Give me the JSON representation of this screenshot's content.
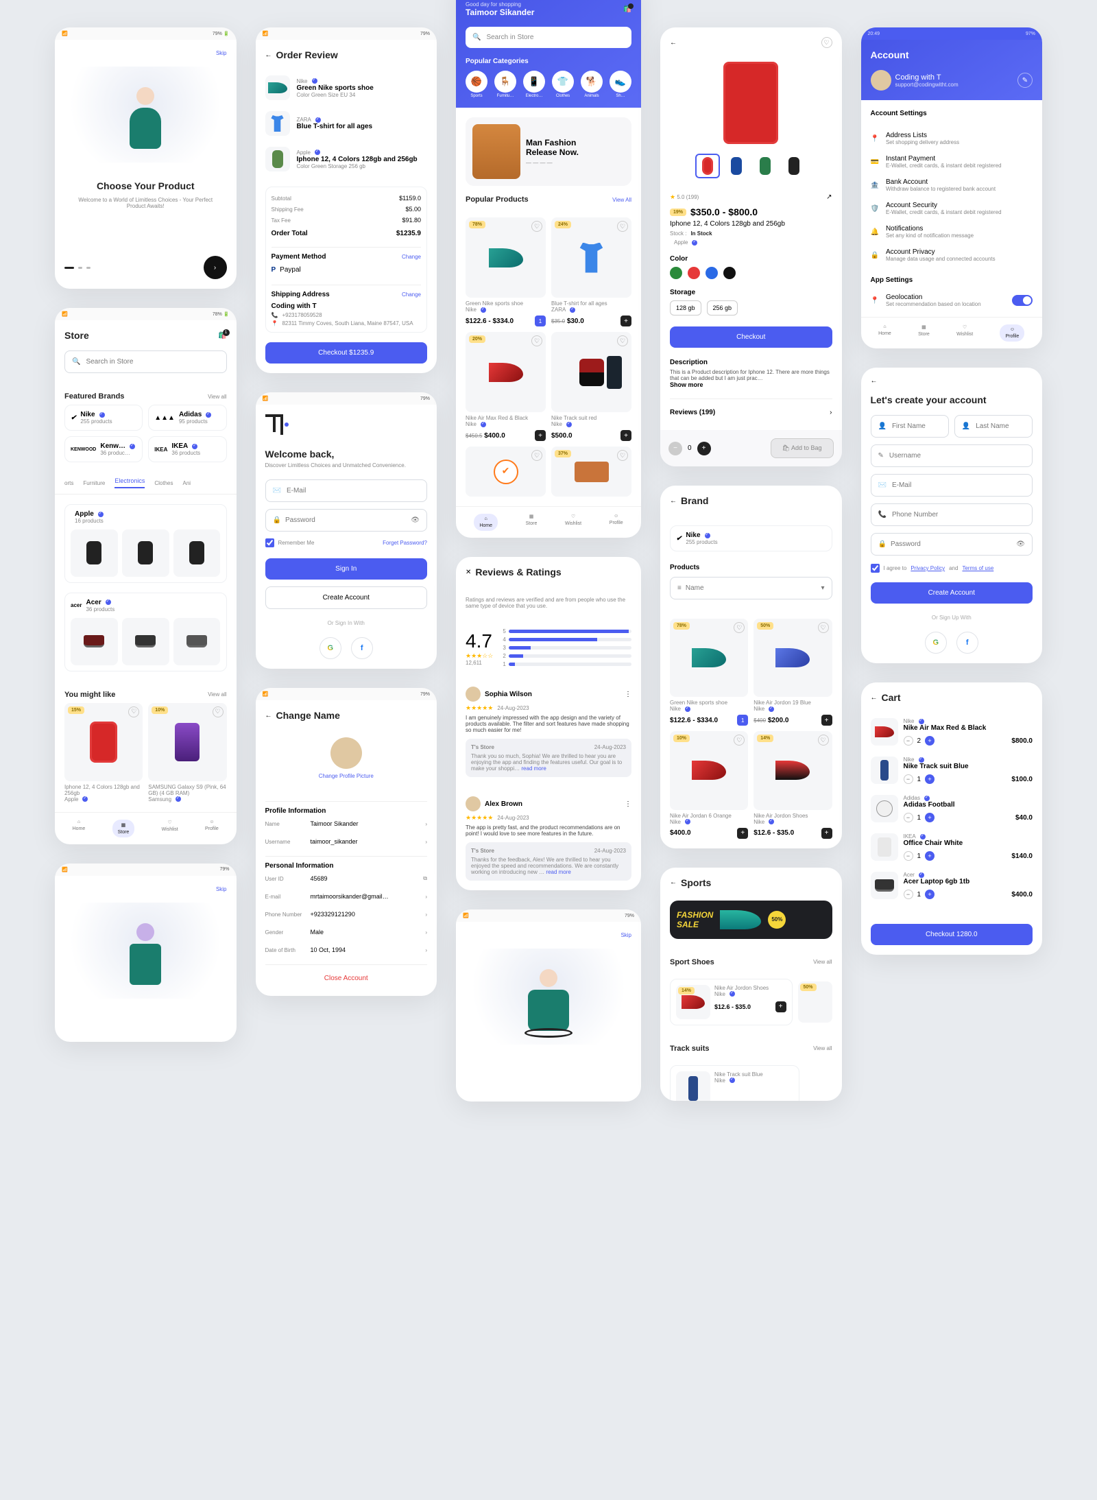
{
  "onboard1": {
    "skip": "Skip",
    "title": "Choose Your Product",
    "desc": "Welcome to a World of Limitless Choices - Your Perfect Product Awaits!"
  },
  "order": {
    "title": "Order Review",
    "items": [
      {
        "brand": "Nike",
        "name": "Green Nike sports shoe",
        "attrs": "Color Green  Size EU 34"
      },
      {
        "brand": "ZARA",
        "name": "Blue T-shirt for all ages"
      },
      {
        "brand": "Apple",
        "name": "Iphone 12, 4 Colors 128gb and 256gb",
        "attrs": "Color Green  Storage 256 gb"
      }
    ],
    "summary": {
      "subtotal_l": "Subtotal",
      "subtotal_v": "$1159.0",
      "ship_l": "Shipping Fee",
      "ship_v": "$5.00",
      "tax_l": "Tax Fee",
      "tax_v": "$91.80",
      "total_l": "Order Total",
      "total_v": "$1235.9"
    },
    "payment_title": "Payment Method",
    "change": "Change",
    "paypal": "Paypal",
    "ship_title": "Shipping Address",
    "ship_name": "Coding with T",
    "ship_phone": "+923178059528",
    "ship_addr": "82311 Timmy Coves, South Liana, Maine 87547, USA",
    "checkout": "Checkout $1235.9"
  },
  "home": {
    "greet1": "Good day for shopping",
    "greet2": "Taimoor Sikander",
    "search": "Search in Store",
    "cat_title": "Popular Categories",
    "cats": [
      "Sports",
      "Furnitu…",
      "Electro…",
      "Clothes",
      "Animals",
      "Sh…"
    ],
    "banner_title": "Man Fashion\nRelease Now.",
    "pp_title": "Popular Products",
    "view_all": "View All",
    "p": [
      {
        "disc": "78%",
        "name": "Green Nike sports shoe",
        "brand": "Nike",
        "price": "$122.6 - $334.0"
      },
      {
        "disc": "24%",
        "name": "Blue T-shirt for all ages",
        "brand": "ZARA",
        "p_old": "$35.0",
        "price": "$30.0"
      },
      {
        "disc": "20%",
        "name": "Nike Air Max Red & Black",
        "brand": "Nike",
        "p_old": "$450.5",
        "price": "$400.0"
      },
      {
        "name": "Nike Track suit red",
        "brand": "Nike",
        "price": "$500.0"
      },
      {
        "disc": "37%"
      }
    ],
    "nav": [
      "Home",
      "Store",
      "Wishlist",
      "Profile"
    ]
  },
  "pdp": {
    "rating": "5.0 (199)",
    "disc": "19%",
    "price": "$350.0 - $800.0",
    "title": "Iphone 12, 4 Colors 128gb and 256gb",
    "stock_l": "Stock :",
    "stock": "In Stock",
    "brand": "Apple",
    "color_l": "Color",
    "storage_l": "Storage",
    "storages": [
      "128 gb",
      "256 gb"
    ],
    "checkout": "Checkout",
    "desc_l": "Description",
    "desc": "This is a Product description for Iphone 12. There are more things that can be added but I am just prac…",
    "showmore": "Show more",
    "reviews": "Reviews (199)",
    "bag": "Add to Bag",
    "qty": "0"
  },
  "account": {
    "time": "20:49",
    "title": "Account",
    "name": "Coding with T",
    "email": "support@codingwitht.com",
    "sect1": "Account Settings",
    "items": [
      {
        "t": "Address Lists",
        "s": "Set shopping delivery address",
        "icon": "📍"
      },
      {
        "t": "Instant Payment",
        "s": "E-Wallet, credit cards, & instant debit registered",
        "icon": "💳"
      },
      {
        "t": "Bank Account",
        "s": "Withdraw balance to registered bank account",
        "icon": "🏦"
      },
      {
        "t": "Account Security",
        "s": "E-Wallet, credit cards, & instant debit registered",
        "icon": "🛡️"
      },
      {
        "t": "Notifications",
        "s": "Set any kind of notification message",
        "icon": "🔔"
      },
      {
        "t": "Account Privacy",
        "s": "Manage data usage and connected accounts",
        "icon": "🔒"
      }
    ],
    "sect2": "App Settings",
    "geo_t": "Geolocation",
    "geo_s": "Set recommendation based on location",
    "nav": [
      "Home",
      "Store",
      "Wishlist",
      "Profile"
    ]
  },
  "store": {
    "title": "Store",
    "search": "Search in Store",
    "fb": "Featured Brands",
    "view": "View all",
    "brands": [
      {
        "n": "Nike",
        "s": "255 products"
      },
      {
        "n": "Adidas",
        "s": "95 products"
      },
      {
        "n": "Kenw…",
        "s": "36 produc…"
      },
      {
        "n": "IKEA",
        "s": "36 products"
      }
    ],
    "tabs": [
      "orts",
      "Furniture",
      "Electronics",
      "Clothes",
      "Ani"
    ],
    "apple_n": "Apple",
    "apple_s": "16 products",
    "acer_n": "Acer",
    "acer_s": "36 products",
    "like": "You might like",
    "rec1_disc": "15%",
    "rec1_n": "Iphone 12, 4 Colors 128gb and 256gb",
    "rec1_b": "Apple",
    "rec2_disc": "10%",
    "rec2_n": "SAMSUNG Galaxy S9 (Pink, 64 GB) (4 GB RAM)",
    "rec2_b": "Samsung",
    "nav": [
      "Home",
      "Store",
      "Wishlist",
      "Profile"
    ]
  },
  "login": {
    "welcome": "Welcome back,",
    "sub": "Discover Limitless Choices and Unmatched Convenience.",
    "email": "E-Mail",
    "password": "Password",
    "remember": "Remember Me",
    "forgot": "Forget Password?",
    "signin": "Sign In",
    "create": "Create Account",
    "orsign": "Or Sign In With"
  },
  "profile": {
    "title": "Change Name",
    "pic": "Change Profile Picture",
    "sect1": "Profile Information",
    "name_l": "Name",
    "name_v": "Taimoor Sikander",
    "user_l": "Username",
    "user_v": "taimoor_sikander",
    "sect2": "Personal Information",
    "uid_l": "User ID",
    "uid_v": "45689",
    "email_l": "E-mail",
    "email_v": "mrtaimoorsikander@gmail…",
    "phone_l": "Phone Number",
    "phone_v": "+923329121290",
    "gender_l": "Gender",
    "gender_v": "Male",
    "dob_l": "Date of Birth",
    "dob_v": "10 Oct, 1994",
    "close": "Close Account"
  },
  "reviews": {
    "title": "Reviews & Ratings",
    "intro": "Ratings and reviews are verified and are from people who use the same type of device that you use.",
    "score": "4.7",
    "count": "12,611",
    "bars": [
      98,
      72,
      18,
      12,
      5
    ],
    "r1_name": "Sophia Wilson",
    "r1_date": "24-Aug-2023",
    "r1_text": "I am genuinely impressed with the app design and the variety of products available. The filter and sort features have made shopping so much easier for me!",
    "r1_reply_title": "T's Store",
    "r1_reply_date": "24-Aug-2023",
    "r1_reply": "Thank you so much, Sophia! We are thrilled to hear you are enjoying the app and finding the features useful. Our goal is to make your shoppi…",
    "r1_more": "read more",
    "r2_name": "Alex Brown",
    "r2_date": "24-Aug-2023",
    "r2_text": "The app is pretty fast, and the product recommendations are on point! I would love to see more features in the future.",
    "r2_reply": "Thanks for the feedback, Alex! We are thrilled to hear you enjoyed the speed and recommendations. We are constantly working on introducing new …",
    "r2_more": "read more"
  },
  "onboard2": {
    "skip": "Skip"
  },
  "brand": {
    "title": "Brand",
    "name": "Nike",
    "sub": "255 products",
    "prod_title": "Products",
    "filter": "Name",
    "p": [
      {
        "disc": "78%",
        "n": "Green Nike sports shoe",
        "b": "Nike",
        "price": "$122.6 - $334.0"
      },
      {
        "disc": "50%",
        "n": "Nike Air Jordon 19 Blue",
        "b": "Nike",
        "old": "$400",
        "price": "$200.0"
      },
      {
        "disc": "10%",
        "n": "Nike Air Jordan 6 Orange",
        "b": "Nike",
        "price": "$400.0"
      },
      {
        "disc": "14%",
        "n": "Nike Air Jordon Shoes",
        "b": "Nike",
        "price": "$12.6 - $35.0"
      }
    ]
  },
  "sports": {
    "title": "Sports",
    "sale": "FASHION\nSALE",
    "badge": "50%",
    "sect": "Sport Shoes",
    "view": "View all",
    "p1_disc": "14%",
    "p1_n": "Nike Air Jordon Shoes",
    "p1_b": "Nike",
    "p1_price": "$12.6 - $35.0",
    "p2_disc": "50%",
    "sect2": "Track suits",
    "ts_n": "Nike Track suit Blue",
    "ts_b": "Nike"
  },
  "signup": {
    "title": "Let's create your account",
    "first": "First Name",
    "last": "Last Name",
    "user": "Username",
    "email": "E-Mail",
    "phone": "Phone Number",
    "password": "Password",
    "agree": "I agree to ",
    "pp": "Privacy Policy",
    "and": " and ",
    "tou": "Terms of use",
    "btn": "Create Account",
    "or": "Or Sign Up With"
  },
  "cart": {
    "title": "Cart",
    "items": [
      {
        "b": "Nike",
        "n": "Nike Air Max Red & Black",
        "q": "2",
        "p": "$800.0"
      },
      {
        "b": "Nike",
        "n": "Nike Track suit Blue",
        "q": "1",
        "p": "$100.0"
      },
      {
        "b": "Adidas",
        "n": "Adidas Football",
        "q": "1",
        "p": "$40.0"
      },
      {
        "b": "IKEA",
        "n": "Office Chair White",
        "q": "1",
        "p": "$140.0"
      },
      {
        "b": "Acer",
        "n": "Acer Laptop 6gb 1tb",
        "q": "1",
        "p": "$400.0"
      }
    ],
    "checkout": "Checkout 1280.0"
  },
  "onboard3": {
    "skip": "Skip"
  }
}
